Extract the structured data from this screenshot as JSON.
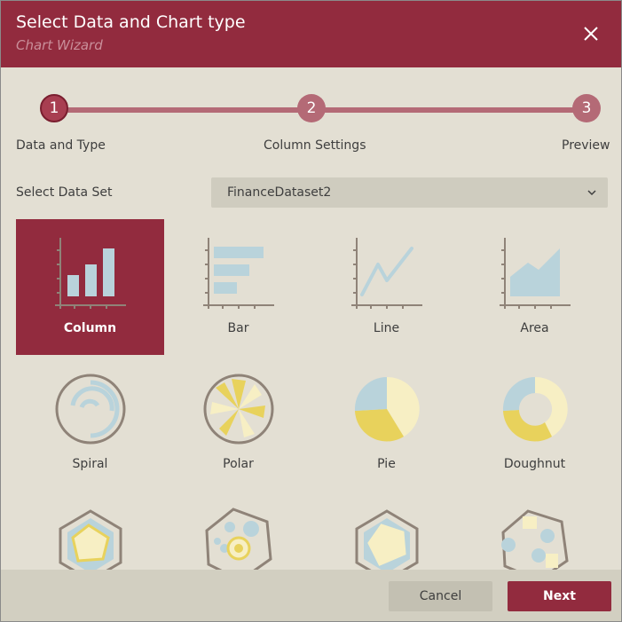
{
  "dialog": {
    "title": "Select Data and Chart type",
    "subtitle": "Chart Wizard",
    "close_icon": "close-icon"
  },
  "steps": [
    {
      "number": "1",
      "label": "Data and Type",
      "active": true
    },
    {
      "number": "2",
      "label": "Column Settings",
      "active": false
    },
    {
      "number": "3",
      "label": "Preview",
      "active": false
    }
  ],
  "dataset": {
    "label": "Select Data Set",
    "value": "FinanceDataset2",
    "icon": "chevron-down-icon"
  },
  "chart_types": [
    {
      "label": "Column",
      "icon": "column-chart-icon",
      "selected": true
    },
    {
      "label": "Bar",
      "icon": "bar-chart-icon",
      "selected": false
    },
    {
      "label": "Line",
      "icon": "line-chart-icon",
      "selected": false
    },
    {
      "label": "Area",
      "icon": "area-chart-icon",
      "selected": false
    },
    {
      "label": "Spiral",
      "icon": "spiral-chart-icon",
      "selected": false
    },
    {
      "label": "Polar",
      "icon": "polar-chart-icon",
      "selected": false
    },
    {
      "label": "Pie",
      "icon": "pie-chart-icon",
      "selected": false
    },
    {
      "label": "Doughnut",
      "icon": "doughnut-chart-icon",
      "selected": false
    },
    {
      "icon": "radar-chart-icon",
      "selected": false
    },
    {
      "icon": "bubble-polygon-chart-icon",
      "selected": false
    },
    {
      "icon": "radar-line-chart-icon",
      "selected": false
    },
    {
      "icon": "scatter-polygon-chart-icon",
      "selected": false
    }
  ],
  "footer": {
    "cancel_label": "Cancel",
    "next_label": "Next"
  },
  "colors": {
    "accent": "#922b3e",
    "step_color": "#b46a76",
    "background": "#e3dfd3",
    "icon_blue": "#b9d3db",
    "icon_yellow": "#e8d25c",
    "icon_cream": "#f7efc4",
    "icon_gray": "#8f8378"
  }
}
